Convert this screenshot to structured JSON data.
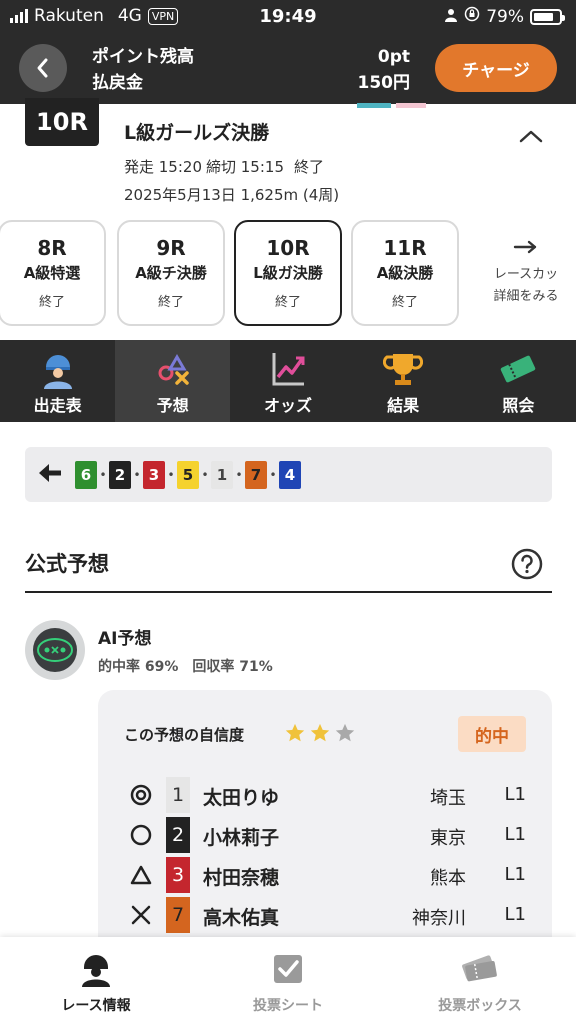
{
  "status_bar": {
    "carrier": "Rakuten",
    "network": "4G",
    "vpn": "VPN",
    "time": "19:49",
    "battery": "79%",
    "battery_level": 0.79
  },
  "header": {
    "points_label": "ポイント残高",
    "points_value": "0pt",
    "refund_label": "払戻金",
    "refund_value": "150円",
    "charge_button": "チャージ"
  },
  "race": {
    "badge": "10R",
    "title": "L級ガールズ決勝",
    "start": "発走 15:20",
    "deadline": "締切 15:15",
    "status": "終了",
    "date_distance": "2025年5月13日 1,625m (4周)"
  },
  "race_tabs": [
    {
      "num": "8R",
      "name": "A級特選",
      "status": "終了"
    },
    {
      "num": "9R",
      "name": "A級チ決勝",
      "status": "終了"
    },
    {
      "num": "10R",
      "name": "L級ガ決勝",
      "status": "終了"
    },
    {
      "num": "11R",
      "name": "A級決勝",
      "status": "終了"
    }
  ],
  "race_tab_more": {
    "line1": "レースカッ",
    "line2": "詳細をみる"
  },
  "main_nav": [
    {
      "label": "出走表",
      "icon": "rider-icon"
    },
    {
      "label": "予想",
      "icon": "prediction-icon"
    },
    {
      "label": "オッズ",
      "icon": "odds-chart-icon"
    },
    {
      "label": "結果",
      "icon": "trophy-icon"
    },
    {
      "label": "照会",
      "icon": "ticket-icon"
    }
  ],
  "order_strip": {
    "icon": "left-arrow-icon",
    "numbers": [
      {
        "n": "6",
        "bg": "#2f8f2f",
        "fg": "#ffffff"
      },
      {
        "n": "2",
        "bg": "#222222",
        "fg": "#ffffff"
      },
      {
        "n": "3",
        "bg": "#c4262e",
        "fg": "#ffffff"
      },
      {
        "n": "5",
        "bg": "#f5d22e",
        "fg": "#222222"
      },
      {
        "n": "1",
        "bg": "#e6e6e6",
        "fg": "#444444"
      },
      {
        "n": "7",
        "bg": "#d4651f",
        "fg": "#222222"
      },
      {
        "n": "4",
        "bg": "#1f45b5",
        "fg": "#ffffff"
      }
    ]
  },
  "section": {
    "title": "公式予想",
    "help_icon": "question-circle-icon"
  },
  "ai": {
    "name": "AI予想",
    "hit_rate": "的中率 69%",
    "return_rate": "回収率 71%",
    "confidence_label": "この予想の自信度",
    "confidence_stars": 2,
    "confidence_max": 3,
    "result_badge": "的中",
    "picks": [
      {
        "mark": "double-circle-icon",
        "num": "1",
        "num_bg": "#e6e6e6",
        "num_fg": "#333333",
        "name": "太田りゆ",
        "pref": "埼玉",
        "class": "L1"
      },
      {
        "mark": "circle-icon",
        "num": "2",
        "num_bg": "#222222",
        "num_fg": "#ffffff",
        "name": "小林莉子",
        "pref": "東京",
        "class": "L1"
      },
      {
        "mark": "triangle-icon",
        "num": "3",
        "num_bg": "#c4262e",
        "num_fg": "#ffffff",
        "name": "村田奈穂",
        "pref": "熊本",
        "class": "L1"
      },
      {
        "mark": "cross-icon",
        "num": "7",
        "num_bg": "#d4651f",
        "num_fg": "#222222",
        "name": "高木佑真",
        "pref": "神奈川",
        "class": "L1"
      }
    ]
  },
  "bottom_nav": [
    {
      "label": "レース情報",
      "icon": "rider-icon"
    },
    {
      "label": "投票シート",
      "icon": "checkbox-icon"
    },
    {
      "label": "投票ボックス",
      "icon": "tickets-icon"
    }
  ],
  "colors": {
    "dark": "#2b2b2b",
    "accent": "#e2782c",
    "hit_bg": "#fbdcc4",
    "hit_fg": "#d5651d",
    "star": "#f0c23a"
  }
}
